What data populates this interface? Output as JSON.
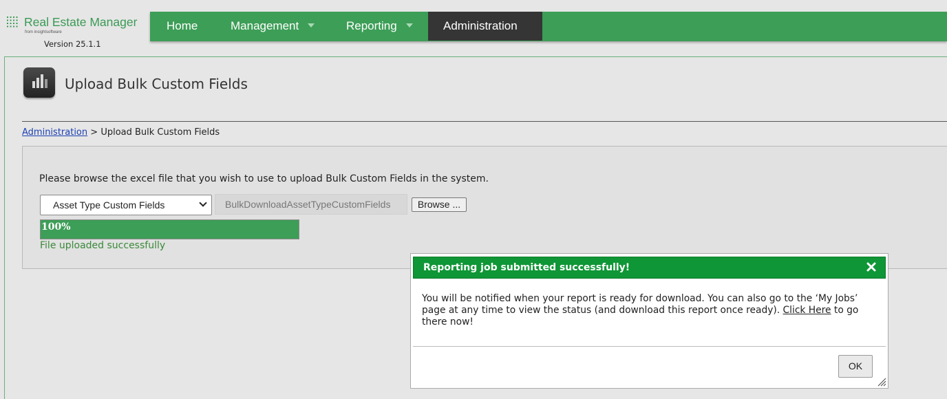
{
  "app": {
    "logo_title": "Real Estate Manager",
    "logo_subtitle": "from insightsoftware",
    "version": "Version 25.1.1",
    "brand_color": "#3d9e57"
  },
  "nav": {
    "home": "Home",
    "management": "Management",
    "reporting": "Reporting",
    "administration": "Administration",
    "active": "Administration"
  },
  "page": {
    "icon": "bulk-upload-icon",
    "title": "Upload Bulk Custom Fields",
    "breadcrumb_link": "Administration",
    "breadcrumb_sep": " > ",
    "breadcrumb_current": "Upload Bulk Custom Fields"
  },
  "upload": {
    "instructions": "Please browse the excel file that you wish to use to upload Bulk Custom Fields in the system.",
    "type_selected": "Asset Type Custom Fields",
    "file_name": "BulkDownloadAssetTypeCustomFields",
    "browse_label": "Browse ...",
    "progress_percent": 100,
    "progress_label": "100%",
    "status_text": "File uploaded successfully"
  },
  "modal": {
    "title": "Reporting job submitted successfully!",
    "body_before_link": "You will be notified when your report is ready for download. You can also go to the ‘My Jobs’ page at any time to view the status (and download this report once ready). ",
    "link_text": "Click Here",
    "body_after_link": " to go there now!",
    "ok_label": "OK",
    "header_color": "#0f9636"
  }
}
